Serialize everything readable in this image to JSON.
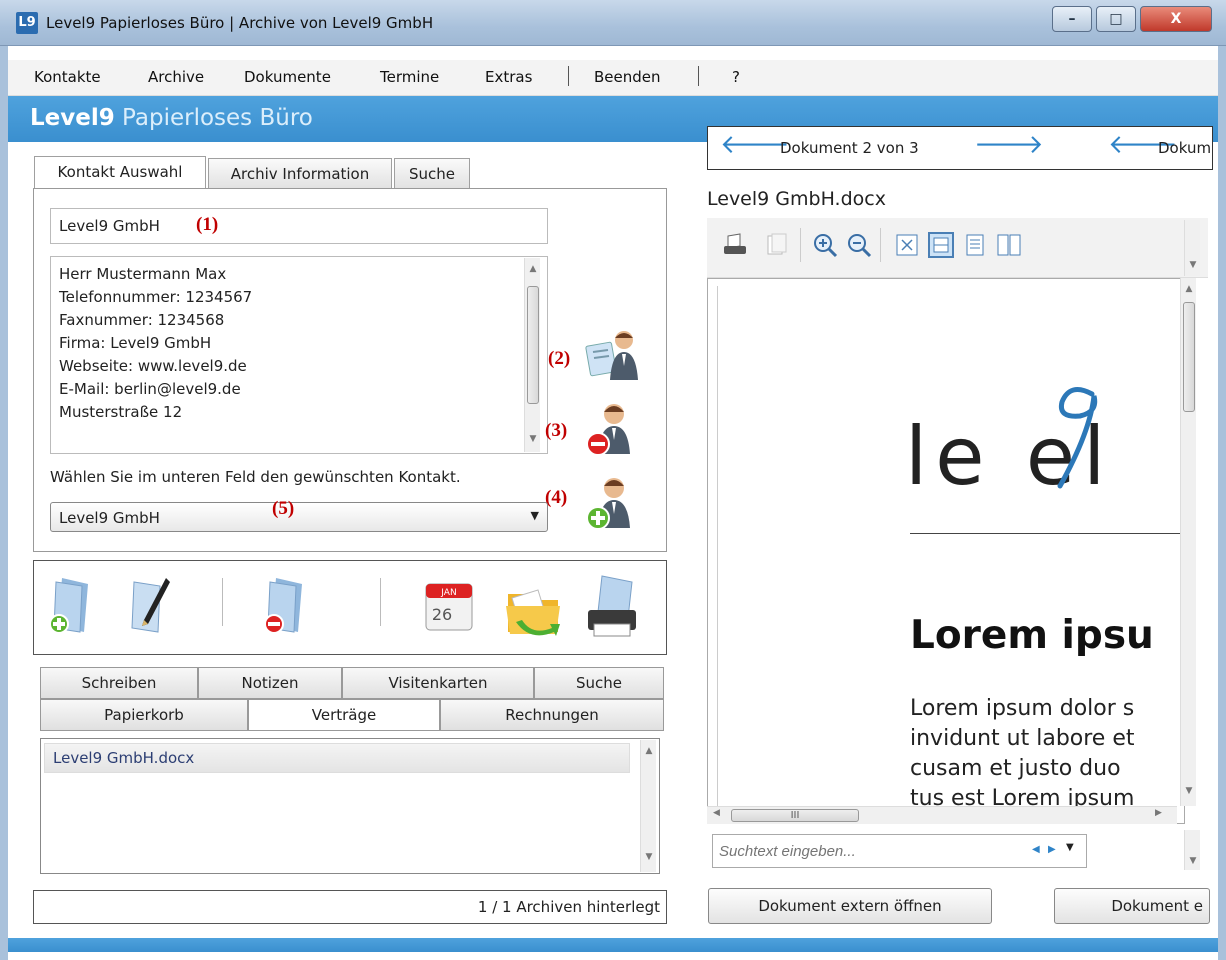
{
  "window": {
    "icon_text": "L9",
    "title": "Level9 Papierloses Büro | Archive von Level9 GmbH",
    "controls": {
      "minimize": "–",
      "maximize": "□",
      "close": "X"
    }
  },
  "menu": {
    "items": [
      "Kontakte",
      "Archive",
      "Dokumente",
      "Termine",
      "Extras",
      "Beenden",
      "?"
    ]
  },
  "brand": {
    "bold": "Level9",
    "light": "Papierloses Büro"
  },
  "tabs": [
    "Kontakt Auswahl",
    "Archiv Information",
    "Suche"
  ],
  "contact": {
    "company": "Level9 GmbH",
    "details": [
      "Herr Mustermann Max",
      "Telefonnummer: 1234567",
      "Faxnummer: 1234568",
      "Firma: Level9 GmbH",
      "Webseite: www.level9.de",
      "E-Mail: berlin@level9.de",
      "Musterstraße 12"
    ],
    "hint": "Wählen Sie im unteren Feld den gewünschten Kontakt.",
    "selected": "Level9 GmbH"
  },
  "annotations": {
    "a1": "(1)",
    "a2": "(2)",
    "a3": "(3)",
    "a4": "(4)",
    "a5": "(5)"
  },
  "calendar_icon": {
    "month": "JAN",
    "day": "26"
  },
  "categories_row1": [
    "Schreiben",
    "Notizen",
    "Visitenkarten",
    "Suche"
  ],
  "categories_row2": [
    "Papierkorb",
    "Verträge",
    "Rechnungen"
  ],
  "files": [
    "Level9 GmbH.docx"
  ],
  "status": "1 / 1 Archiven hinterlegt",
  "docnav": {
    "label": "Dokument 2 von 3",
    "label_right": "Dokum"
  },
  "document": {
    "filename": "Level9 GmbH.docx",
    "logo": "le el",
    "heading": "Lorem ipsu",
    "body": "Lorem ipsum dolor s\ninvidunt ut labore et\ncusam et justo duo \ntus est Lorem ipsum"
  },
  "viewer": {
    "search_placeholder": "Suchtext eingeben...",
    "hscroll_label": "III"
  },
  "buttons": {
    "open_external": "Dokument extern öffnen",
    "second": "Dokument e"
  },
  "colors": {
    "accent": "#3a8fcf",
    "annotation": "#c00000",
    "nav_arrow": "#2f84c8"
  }
}
